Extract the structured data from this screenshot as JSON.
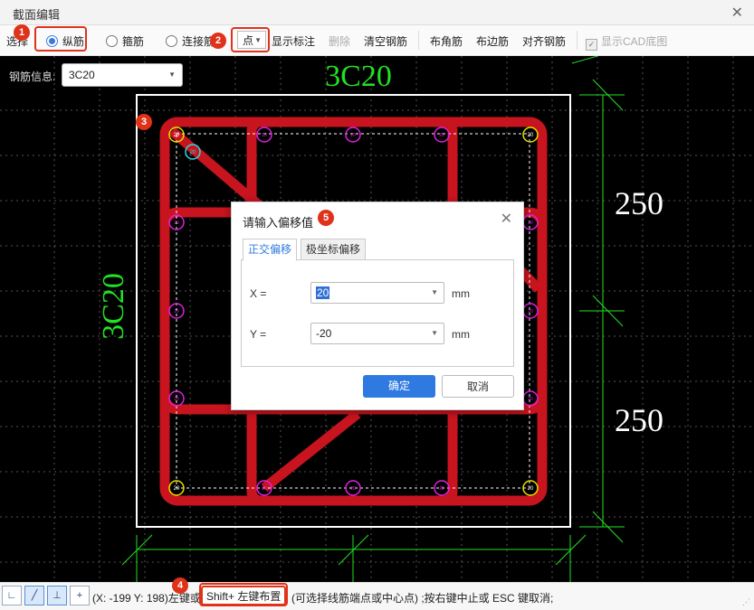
{
  "window": {
    "title": "截面编辑",
    "close_glyph": "✕"
  },
  "toolbar": {
    "select_label": "选择",
    "radio_longitudinal": "纵筋",
    "radio_stirrup": "箍筋",
    "radio_tie": "连接筋",
    "point_mode": "点",
    "show_annotation": "显示标注",
    "delete": "删除",
    "clear_rebar": "清空钢筋",
    "corner_rebar": "布角筋",
    "edge_rebar": "布边筋",
    "align_rebar": "对齐钢筋",
    "show_cad_bg": "显示CAD底图"
  },
  "rebar_info": {
    "label": "钢筋信息:",
    "value": "3C20"
  },
  "canvas": {
    "top_label": "3C20",
    "left_label": "3C20",
    "dim_upper": "250",
    "dim_lower": "250",
    "corner_mark": "20",
    "edge_mark": "20"
  },
  "dialog": {
    "title": "请输入偏移值",
    "tab_ortho": "正交偏移",
    "tab_polar": "极坐标偏移",
    "x_label": "X =",
    "x_value": "20",
    "y_label": "Y =",
    "y_value": "-20",
    "unit": "mm",
    "ok": "确定",
    "cancel": "取消"
  },
  "statusbar": {
    "coords": "(X: -199 Y: 198)左键或",
    "key_hint": "Shift+ 左键布置",
    "hint_rest": "(可选择线筋端点或中心点) ;按右键中止或 ESC 键取消;"
  },
  "badges": [
    "1",
    "2",
    "3",
    "4",
    "5"
  ],
  "colors": {
    "accent": "#2f7ae0",
    "highlight_red": "#e0321a",
    "rebar_red": "#c8141e",
    "annotation_green": "#22e022",
    "corner_yellow": "#e8e000",
    "edge_magenta": "#e020e0"
  }
}
